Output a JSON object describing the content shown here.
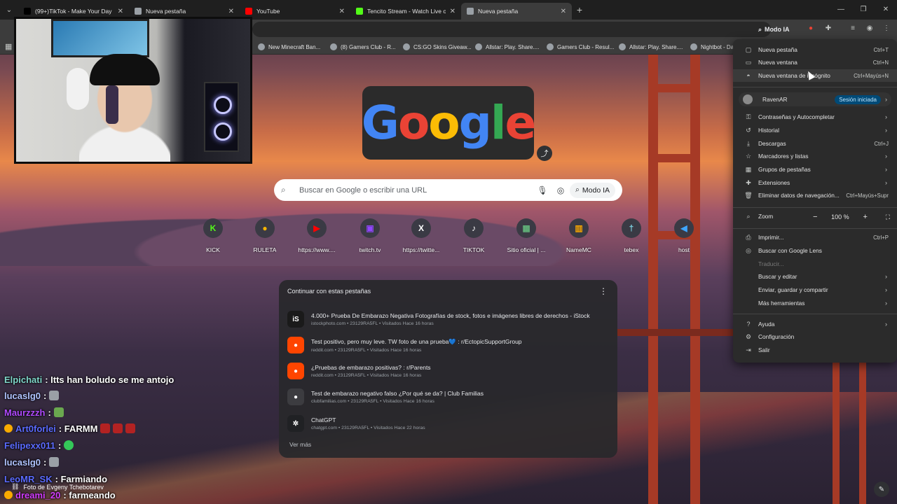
{
  "tabs": [
    {
      "title": "(99+)TikTok - Make Your Day",
      "favicon_color": "#000000",
      "active": false
    },
    {
      "title": "Nueva pestaña",
      "favicon_color": "#9aa0a6",
      "active": false
    },
    {
      "title": "YouTube",
      "favicon_color": "#ff0000",
      "active": false
    },
    {
      "title": "Tencito Stream - Watch Live on",
      "favicon_color": "#53fc18",
      "active": false
    },
    {
      "title": "Nueva pestaña",
      "favicon_color": "#9aa0a6",
      "active": true
    }
  ],
  "toolbar": {
    "modo_ia": "Modo IA"
  },
  "bookmarks": [
    "New Minecraft Ban...",
    "(8) Gamers Club - R...",
    "CS:GO Skins Giveaw...",
    "Allstar: Play. Share....",
    "Gamers Club - Resul...",
    "Allstar: Play. Share....",
    "Nightbot - Da"
  ],
  "chat": [
    {
      "user": "Elpichati",
      "msg": ": Itts han boludo se me antojo",
      "color": "#7fd6c9"
    },
    {
      "user": "lucaslg0",
      "msg": ":",
      "color": "#b0c4ff"
    },
    {
      "user": "Maurzzzh",
      "msg": ":",
      "color": "#b04aff"
    },
    {
      "user": "Art0forlei",
      "msg": ": FARMM",
      "color": "#5b6bff"
    },
    {
      "user": "Felipexx011",
      "msg": ":",
      "color": "#5b6bff"
    },
    {
      "user": "lucaslg0",
      "msg": ":",
      "color": "#b0c4ff"
    },
    {
      "user": "LeoMR_SK",
      "msg": ": Farmiando",
      "color": "#5b6bff"
    },
    {
      "user": "dreami_20",
      "msg": ": farmeando",
      "color": "#d23cff"
    }
  ],
  "photo_credit": "Foto de Evgeny Tchebotarev",
  "doodle_letters": [
    "G",
    "o",
    "o",
    "g",
    "l",
    "e"
  ],
  "search": {
    "placeholder": "Buscar en Google o escribir una URL",
    "modo_ia": "Modo IA"
  },
  "shortcuts": [
    {
      "label": "KICK",
      "glyph": "K",
      "color": "#53fc18"
    },
    {
      "label": "RULETA",
      "glyph": "●",
      "color": "#f4b400"
    },
    {
      "label": "https://www....",
      "glyph": "▶",
      "color": "#ff0000"
    },
    {
      "label": "twitch.tv",
      "glyph": "▣",
      "color": "#9146ff"
    },
    {
      "label": "https://twitte...",
      "glyph": "X",
      "color": "#ffffff"
    },
    {
      "label": "TIKTOK",
      "glyph": "♪",
      "color": "#ffffff"
    },
    {
      "label": "Sitio oficial | ...",
      "glyph": "▦",
      "color": "#62b47a"
    },
    {
      "label": "NameMC",
      "glyph": "▥",
      "color": "#f4a400"
    },
    {
      "label": "tebex",
      "glyph": "†",
      "color": "#7fd6e6"
    },
    {
      "label": "host",
      "glyph": "◀",
      "color": "#3ea6ff"
    }
  ],
  "continue": {
    "title": "Continuar con estas pestañas",
    "items": [
      {
        "title": "4.000+ Prueba De Embarazo Negativa Fotografías de stock, fotos e imágenes libres de derechos - iStock",
        "meta": "istockphoto.com • 23129RA5FL • Visitados Hace 16 horas",
        "icon": "iS",
        "icon_bg": "#1a1a1a"
      },
      {
        "title": "Test positivo, pero muy leve. TW foto de una prueba💙 : r/EctopicSupportGroup",
        "meta": "reddit.com • 23129RA5FL • Visitados Hace 16 horas",
        "icon": "●",
        "icon_bg": "#ff4500"
      },
      {
        "title": "¿Pruebas de embarazo positivas? : r/Parents",
        "meta": "reddit.com • 23129RA5FL • Visitados Hace 16 horas",
        "icon": "●",
        "icon_bg": "#ff4500"
      },
      {
        "title": "Test de embarazo negativo falso ¿Por qué se da? | Club Familias",
        "meta": "clubfamilias.com • 23129RA5FL • Visitados Hace 16 horas",
        "icon": "●",
        "icon_bg": "#3c3c40"
      },
      {
        "title": "ChatGPT",
        "meta": "chatgpt.com • 23129RA5FL • Visitados Hace 22 horas",
        "icon": "✲",
        "icon_bg": "#202124"
      }
    ],
    "ver_mas": "Ver más"
  },
  "menu": {
    "group1": [
      {
        "label": "Nueva pestaña",
        "shortcut": "Ctrl+T",
        "icon": "new-tab-icon",
        "glyph": "▢"
      },
      {
        "label": "Nueva ventana",
        "shortcut": "Ctrl+N",
        "icon": "new-window-icon",
        "glyph": "▭"
      },
      {
        "label": "Nueva ventana de incógnito",
        "shortcut": "Ctrl+Mayús+N",
        "icon": "incognito-icon",
        "glyph": "◓"
      }
    ],
    "profile": {
      "name": "RavenAR",
      "status": "Sesión iniciada"
    },
    "group2": [
      {
        "label": "Contraseñas y Autocompletar",
        "shortcut": "",
        "icon": "key-icon",
        "glyph": "⚿",
        "arrow": true
      },
      {
        "label": "Historial",
        "shortcut": "",
        "icon": "history-icon",
        "glyph": "↺",
        "arrow": true
      },
      {
        "label": "Descargas",
        "shortcut": "Ctrl+J",
        "icon": "download-icon",
        "glyph": "⤓",
        "arrow": false
      },
      {
        "label": "Marcadores y listas",
        "shortcut": "",
        "icon": "star-icon",
        "glyph": "☆",
        "arrow": true
      },
      {
        "label": "Grupos de pestañas",
        "shortcut": "",
        "icon": "tab-groups-icon",
        "glyph": "▦",
        "arrow": true
      },
      {
        "label": "Extensiones",
        "shortcut": "",
        "icon": "puzzle-icon",
        "glyph": "✚",
        "arrow": true
      },
      {
        "label": "Eliminar datos de navegación...",
        "shortcut": "Ctrl+Mayús+Supr",
        "icon": "trash-icon",
        "glyph": "🗑",
        "arrow": false
      }
    ],
    "zoom": {
      "label": "Zoom",
      "value": "100 %"
    },
    "group3": [
      {
        "label": "Imprimir...",
        "shortcut": "Ctrl+P",
        "icon": "print-icon",
        "glyph": "⎙",
        "arrow": false,
        "disabled": false
      },
      {
        "label": "Buscar con Google Lens",
        "shortcut": "",
        "icon": "lens-icon",
        "glyph": "◎",
        "arrow": false,
        "disabled": false
      },
      {
        "label": "Traducir...",
        "shortcut": "",
        "icon": "translate-icon",
        "glyph": "",
        "arrow": false,
        "disabled": true
      },
      {
        "label": "Buscar y editar",
        "shortcut": "",
        "icon": "find-edit-icon",
        "glyph": "",
        "arrow": true,
        "disabled": false
      },
      {
        "label": "Enviar, guardar y compartir",
        "shortcut": "",
        "icon": "share-icon",
        "glyph": "",
        "arrow": true,
        "disabled": false
      },
      {
        "label": "Más herramientas",
        "shortcut": "",
        "icon": "tools-icon",
        "glyph": "",
        "arrow": true,
        "disabled": false
      }
    ],
    "group4": [
      {
        "label": "Ayuda",
        "icon": "help-icon",
        "glyph": "?",
        "arrow": true
      },
      {
        "label": "Configuración",
        "icon": "settings-icon",
        "glyph": "⚙",
        "arrow": false
      },
      {
        "label": "Salir",
        "icon": "exit-icon",
        "glyph": "⇥",
        "arrow": false
      }
    ]
  }
}
